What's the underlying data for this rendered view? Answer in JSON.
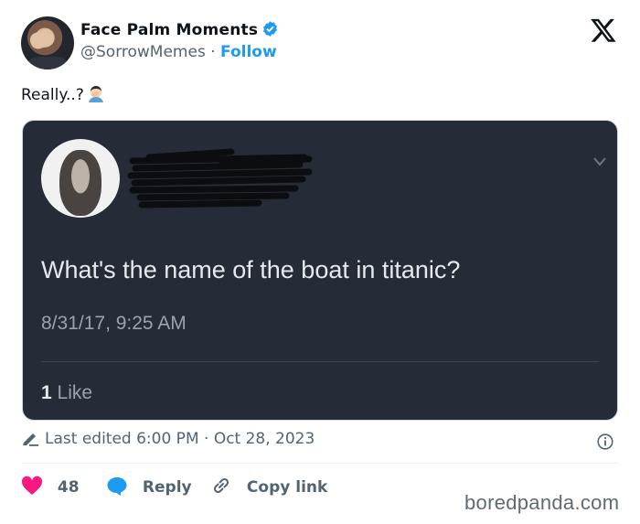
{
  "author": {
    "display_name": "Face Palm Moments",
    "handle": "@SorrowMemes",
    "separator": "·",
    "follow_label": "Follow"
  },
  "post": {
    "text": "Really..?"
  },
  "embedded": {
    "question": "What's the name of the boat in titanic?",
    "timestamp": "8/31/17, 9:25 AM",
    "like_count": "1",
    "like_label": "Like"
  },
  "meta": {
    "edited": "Last edited 6:00 PM · Oct 28, 2023"
  },
  "actions": {
    "likes": "48",
    "reply_label": "Reply",
    "copy_label": "Copy link"
  },
  "watermark": "boredpanda.com",
  "colors": {
    "accent": "#1d9bf0",
    "heart": "#f91880",
    "media_bg": "#262c37"
  },
  "icons": [
    "verified-icon",
    "x-logo-icon",
    "facepalm-emoji-icon",
    "chevron-down-icon",
    "pencil-icon",
    "info-icon",
    "heart-icon",
    "reply-icon",
    "link-icon"
  ]
}
